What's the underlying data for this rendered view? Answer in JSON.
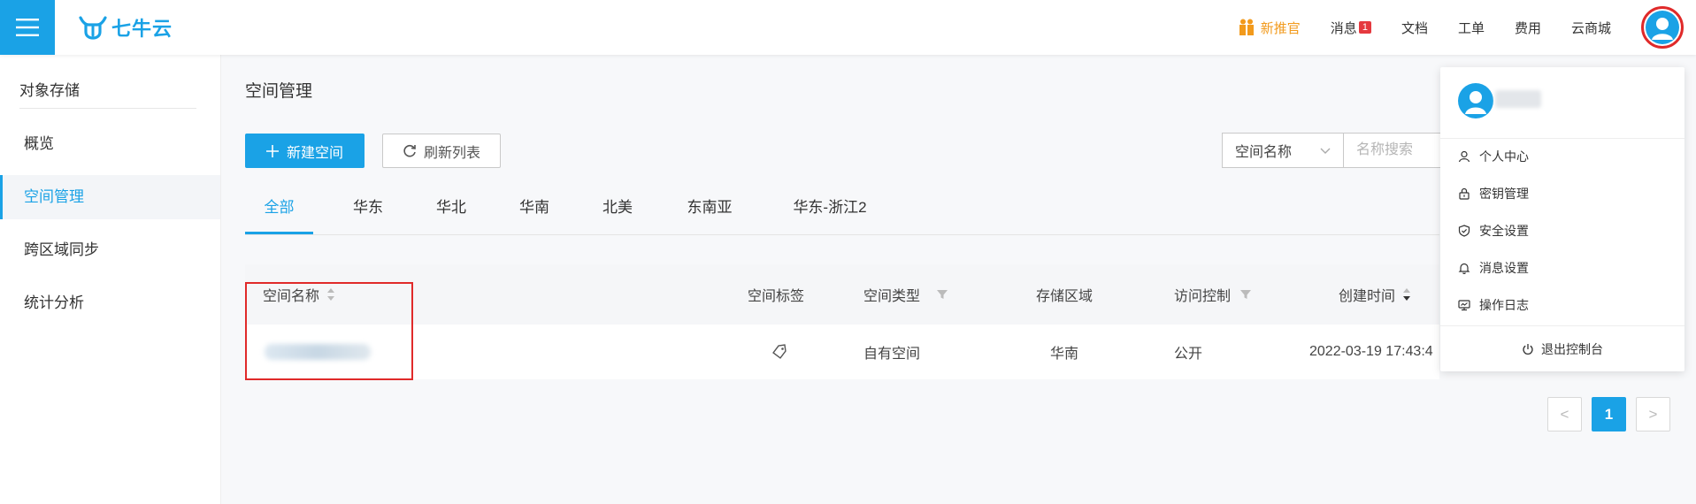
{
  "brand": {
    "logo_text": "七牛云",
    "accent": "#1aa2e6"
  },
  "topnav": {
    "promo": "新推官",
    "messages": "消息",
    "message_count": "1",
    "docs": "文档",
    "tickets": "工单",
    "billing": "费用",
    "market": "云商城"
  },
  "sidebar": {
    "title": "对象存储",
    "items": [
      {
        "label": "概览"
      },
      {
        "label": "空间管理"
      },
      {
        "label": "跨区域同步"
      },
      {
        "label": "统计分析"
      }
    ]
  },
  "main": {
    "title": "空间管理",
    "new_button": "新建空间",
    "refresh_button": "刷新列表",
    "search": {
      "select_value": "空间名称",
      "placeholder": "名称搜索"
    },
    "tabs": [
      {
        "label": "全部"
      },
      {
        "label": "华东"
      },
      {
        "label": "华北"
      },
      {
        "label": "华南"
      },
      {
        "label": "北美"
      },
      {
        "label": "东南亚"
      },
      {
        "label": "华东-浙江2"
      }
    ],
    "table": {
      "columns": [
        "空间名称",
        "空间标签",
        "空间类型",
        "存储区域",
        "访问控制",
        "创建时间"
      ],
      "rows": [
        {
          "name": "",
          "type": "自有空间",
          "region": "华南",
          "access": "公开",
          "created": "2022-03-19 17:43:4"
        }
      ]
    },
    "pagination": {
      "current": "1",
      "prev": "<",
      "next": ">"
    }
  },
  "user_menu": {
    "items": [
      {
        "label": "个人中心",
        "icon": "user-icon"
      },
      {
        "label": "密钥管理",
        "icon": "lock-icon"
      },
      {
        "label": "安全设置",
        "icon": "shield-icon"
      },
      {
        "label": "消息设置",
        "icon": "bell-icon"
      },
      {
        "label": "操作日志",
        "icon": "log-icon"
      }
    ],
    "logout": "退出控制台"
  },
  "colors": {
    "accent": "#1aa2e6",
    "highlight": "#e02a2a",
    "promo": "#f29a1c",
    "badge": "#e5393f"
  }
}
